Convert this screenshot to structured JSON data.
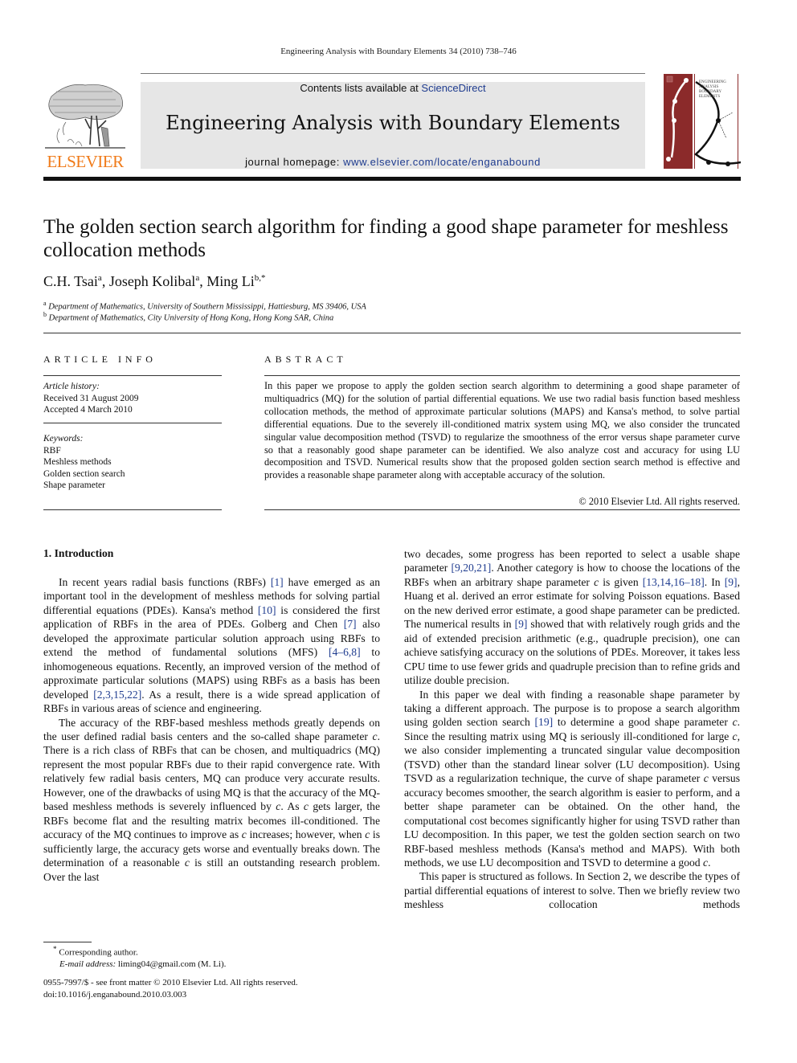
{
  "running_head": "Engineering Analysis with Boundary Elements 34 (2010) 738–746",
  "publisher": {
    "logo_word": "ELSEVIER",
    "logo_icon": "elsevier-tree-icon",
    "brand_color": "#f07b1a"
  },
  "masthead": {
    "contents_prefix": "Contents lists available at ",
    "contents_link": "ScienceDirect",
    "journal_title": "Engineering Analysis with Boundary Elements",
    "homepage_prefix": "journal homepage: ",
    "homepage_link": "www.elsevier.com/locate/enganabound",
    "link_color": "#1f3c8f",
    "cover_icon": "journal-cover-icon",
    "cover_title_lines": [
      "ENGINEERING",
      "ANALYSIS with",
      "BOUNDARY",
      "ELEMENTS"
    ],
    "cover_color": "#8b2a2a"
  },
  "article": {
    "title": "The golden section search algorithm for finding a good shape parameter for meshless collocation methods",
    "authors": [
      {
        "name": "C.H. Tsai",
        "sup": "a"
      },
      {
        "name": "Joseph Kolibal",
        "sup": "a"
      },
      {
        "name": "Ming Li",
        "sup": "b,*"
      }
    ],
    "author_separator": ", ",
    "affiliations": [
      {
        "sup": "a",
        "text": "Department of Mathematics, University of Southern Mississippi, Hattiesburg, MS 39406, USA"
      },
      {
        "sup": "b",
        "text": "Department of Mathematics, City University of Hong Kong, Hong Kong SAR, China"
      }
    ]
  },
  "article_info": {
    "heading": "ARTICLE INFO",
    "history_label": "Article history:",
    "received": "Received 31 August 2009",
    "accepted": "Accepted 4 March 2010",
    "keywords_label": "Keywords:",
    "keywords": [
      "RBF",
      "Meshless methods",
      "Golden section search",
      "Shape parameter"
    ]
  },
  "abstract": {
    "heading": "ABSTRACT",
    "text": "In this paper we propose to apply the golden section search algorithm to determining a good shape parameter of multiquadrics (MQ) for the solution of partial differential equations. We use two radial basis function based meshless collocation methods, the method of approximate particular solutions (MAPS) and Kansa's method, to solve partial differential equations. Due to the severely ill-conditioned matrix system using MQ, we also consider the truncated singular value decomposition method (TSVD) to regularize the smoothness of the error versus shape parameter curve so that a reasonably good shape parameter can be identified. We also analyze cost and accuracy for using LU decomposition and TSVD. Numerical results show that the proposed golden section search method is effective and provides a reasonable shape parameter along with acceptable accuracy of the solution.",
    "copyright": "© 2010 Elsevier Ltd. All rights reserved."
  },
  "body": {
    "section_heading": "1.  Introduction",
    "left_paragraphs": [
      [
        {
          "t": "In recent years radial basis functions (RBFs) "
        },
        {
          "r": "[1]"
        },
        {
          "t": " have emerged as an important tool in the development of meshless methods for solving partial differential equations (PDEs). Kansa's method "
        },
        {
          "r": "[10]"
        },
        {
          "t": " is considered the first application of RBFs in the area of PDEs. Golberg and Chen "
        },
        {
          "r": "[7]"
        },
        {
          "t": " also developed the approximate particular solution approach using RBFs to extend the method of fundamental solutions (MFS) "
        },
        {
          "r": "[4–6,8]"
        },
        {
          "t": " to inhomogeneous equations. Recently, an improved version of the method of approximate particular solutions (MAPS) using RBFs as a basis has been developed "
        },
        {
          "r": "[2,3,15,22]"
        },
        {
          "t": ". As a result, there is a wide spread application of RBFs in various areas of science and engineering."
        }
      ],
      [
        {
          "t": "The accuracy of the RBF-based meshless methods greatly depends on the user defined radial basis centers and the so-called shape parameter "
        },
        {
          "i": "c"
        },
        {
          "t": ". There is a rich class of RBFs that can be chosen, and multiquadrics (MQ) represent the most popular RBFs due to their rapid convergence rate. With relatively few radial basis centers, MQ can produce very accurate results. However, one of the drawbacks of using MQ is that the accuracy of the MQ-based meshless methods is severely influenced by "
        },
        {
          "i": "c"
        },
        {
          "t": ". As "
        },
        {
          "i": "c"
        },
        {
          "t": " gets larger, the RBFs become flat and the resulting matrix becomes ill-conditioned. The accuracy of the MQ continues to improve as "
        },
        {
          "i": "c"
        },
        {
          "t": " increases; however, when "
        },
        {
          "i": "c"
        },
        {
          "t": " is sufficiently large, the accuracy gets worse and eventually breaks down. The determination of a reasonable "
        },
        {
          "i": "c"
        },
        {
          "t": " is still an outstanding research problem. Over the last"
        }
      ]
    ],
    "right_paragraphs": [
      [
        {
          "t": "two decades, some progress has been reported to select a usable shape parameter "
        },
        {
          "r": "[9,20,21]"
        },
        {
          "t": ". Another category is how to choose the locations of the RBFs when an arbitrary shape parameter "
        },
        {
          "i": "c"
        },
        {
          "t": " is given "
        },
        {
          "r": "[13,14,16–18]"
        },
        {
          "t": ". In "
        },
        {
          "r": "[9]"
        },
        {
          "t": ", Huang et al. derived an error estimate for solving Poisson equations. Based on the new derived error estimate, a good shape parameter can be predicted. The numerical results in "
        },
        {
          "r": "[9]"
        },
        {
          "t": " showed that with relatively rough grids and the aid of extended precision arithmetic (e.g., quadruple precision), one can achieve satisfying accuracy on the solutions of PDEs. Moreover, it takes less CPU time to use fewer grids and quadruple precision than to refine grids and utilize double precision."
        }
      ],
      [
        {
          "t": "In this paper we deal with finding a reasonable shape parameter by taking a different approach. The purpose is to propose a search algorithm using golden section search "
        },
        {
          "r": "[19]"
        },
        {
          "t": " to determine a good shape parameter "
        },
        {
          "i": "c"
        },
        {
          "t": ". Since the resulting matrix using MQ is seriously ill-conditioned for large "
        },
        {
          "i": "c"
        },
        {
          "t": ", we also consider implementing a truncated singular value decomposition (TSVD) other than the standard linear solver (LU decomposition). Using TSVD as a regularization technique, the curve of shape parameter "
        },
        {
          "i": "c"
        },
        {
          "t": " versus accuracy becomes smoother, the search algorithm is easier to perform, and a better shape parameter can be obtained. On the other hand, the computational cost becomes significantly higher for using TSVD rather than LU decomposition. In this paper, we test the golden section search on two RBF-based meshless methods (Kansa's method and MAPS). With both methods, we use LU decomposition and TSVD to determine a good "
        },
        {
          "i": "c"
        },
        {
          "t": "."
        }
      ],
      [
        {
          "t": "This paper is structured as follows. In Section 2, we describe the types of partial differential equations of interest to solve. Then we briefly review two meshless collocation methods"
        }
      ]
    ]
  },
  "footnote": {
    "marker": "*",
    "corresponding": "Corresponding author.",
    "email_label": "E-mail address:",
    "email": "liming04@gmail.com (M. Li)."
  },
  "footer": {
    "issn_line": "0955-7997/$ - see front matter © 2010 Elsevier Ltd. All rights reserved.",
    "doi": "doi:10.1016/j.enganabound.2010.03.003"
  }
}
